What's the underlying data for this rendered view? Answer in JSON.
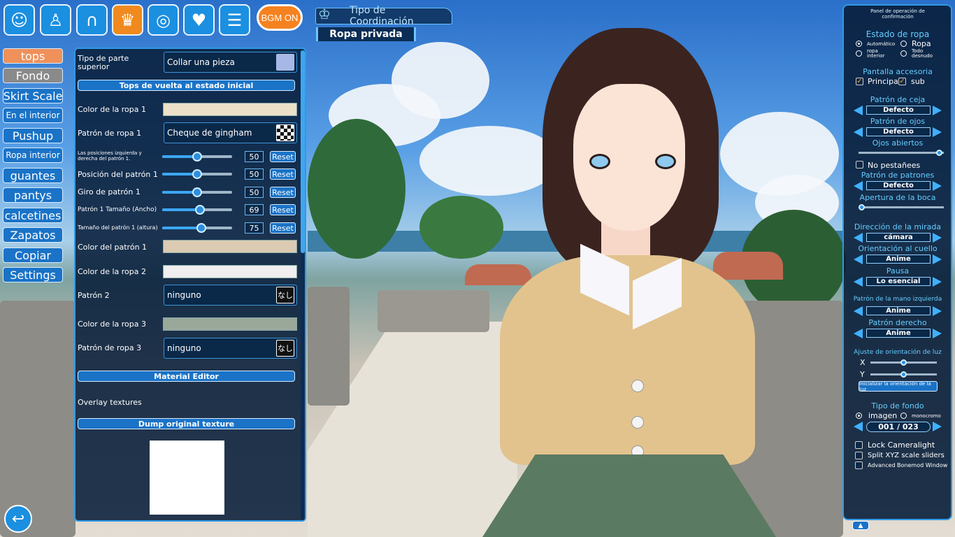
{
  "topbar": {
    "icons": [
      "face-icon",
      "body-icon",
      "hair-icon",
      "clothes-icon",
      "accessory-icon",
      "heart-icon",
      "menu-icon"
    ],
    "bgm_label": "BGM ON",
    "coordination_title": "Tipo de Coordinación",
    "coordination_value": "Ropa privada"
  },
  "categories": [
    "tops",
    "Fondo",
    "Skirt Scale",
    "En el interior",
    "Pushup",
    "Ropa interior",
    "guantes",
    "pantys",
    "calcetines",
    "Zapatos",
    "Copiar",
    "Settings"
  ],
  "panel": {
    "part_type_label": "Tipo de parte superior",
    "part_type_value": "Collar una pieza",
    "reset_tops_button": "Tops de vuelta al estado inicial",
    "color1_label": "Color de la ropa 1",
    "pattern1_label": "Patrón de ropa 1",
    "pattern1_value": "Cheque de gingham",
    "sliders": [
      {
        "label": "Las posiciones izquierda y derecha del patrón 1.",
        "value": "50",
        "level": 0.5,
        "reset": "Reset"
      },
      {
        "label": "Posición del patrón 1",
        "value": "50",
        "level": 0.5,
        "reset": "Reset"
      },
      {
        "label": "Giro de patrón 1",
        "value": "50",
        "level": 0.5,
        "reset": "Reset"
      },
      {
        "label": "Patrón 1 Tamaño (Ancho)",
        "value": "69",
        "level": 0.55,
        "reset": "Reset"
      },
      {
        "label": "Tamaño del patrón 1 (altura)",
        "value": "75",
        "level": 0.57,
        "reset": "Reset"
      }
    ],
    "pattern_color1_label": "Color del patrón 1",
    "color2_label": "Color de la ropa 2",
    "pattern2_label": "Patrón 2",
    "pattern2_value": "ninguno",
    "color3_label": "Color de la ropa 3",
    "pattern3_label": "Patrón de ropa 3",
    "pattern3_value": "ninguno",
    "none_glyph": "なし",
    "material_editor_button": "Material Editor",
    "overlay_textures_label": "Overlay textures",
    "dump_texture_button": "Dump original texture",
    "colors": {
      "color1": "#ece0c8",
      "pattern_color1": "#dccbb2",
      "color2": "#f0eeee",
      "color3": "#9aa89a"
    }
  },
  "right": {
    "header": "Panel de operación de confirmación",
    "clothes_state_title": "Estado de ropa",
    "state_auto": "Automático",
    "state_ropa": "Ropa",
    "state_underwear": "ropa interior",
    "state_nude": "Todo desnudo",
    "accessory_title": "Pantalla accesoria",
    "acc_principal": "Principal",
    "acc_sub": "sub",
    "eyebrow_title": "Patrón de ceja",
    "eyebrow_value": "Defecto",
    "eyes_title": "Patrón de ojos",
    "eyes_value": "Defecto",
    "eyes_open_title": "Ojos abiertos",
    "eyes_open_level": 0.98,
    "no_blink": "No pestañees",
    "patterns_title": "Patrón de patrones",
    "patterns_value": "Defecto",
    "mouth_title": "Apertura de la boca",
    "mouth_level": 0.0,
    "gaze_title": "Dirección de la mirada",
    "gaze_value": "cámara",
    "neck_title": "Orientación al cuello",
    "neck_value": "Anime",
    "pose_title": "Pausa",
    "pose_value": "Lo esencial",
    "lefthand_title": "Patrón de la mano izquierda",
    "lefthand_value": "Anime",
    "righthand_title": "Patrón derecho",
    "righthand_value": "Anime",
    "light_title": "Ajuste de orientación de luz",
    "light_x": "X",
    "light_y": "Y",
    "light_x_level": 0.5,
    "light_y_level": 0.5,
    "light_reset": "Inicializar la orientación de la luz",
    "bg_title": "Tipo de fondo",
    "bg_image": "imagen",
    "bg_mono": "monocromo",
    "bg_value": "001 / 023",
    "lock_cameralight": "Lock Cameralight",
    "split_xyz": "Split XYZ scale sliders",
    "advanced_bonemod": "Advanced Bonemod Window"
  },
  "nav": {
    "back_glyph": "↩",
    "up_glyph": "▲"
  }
}
